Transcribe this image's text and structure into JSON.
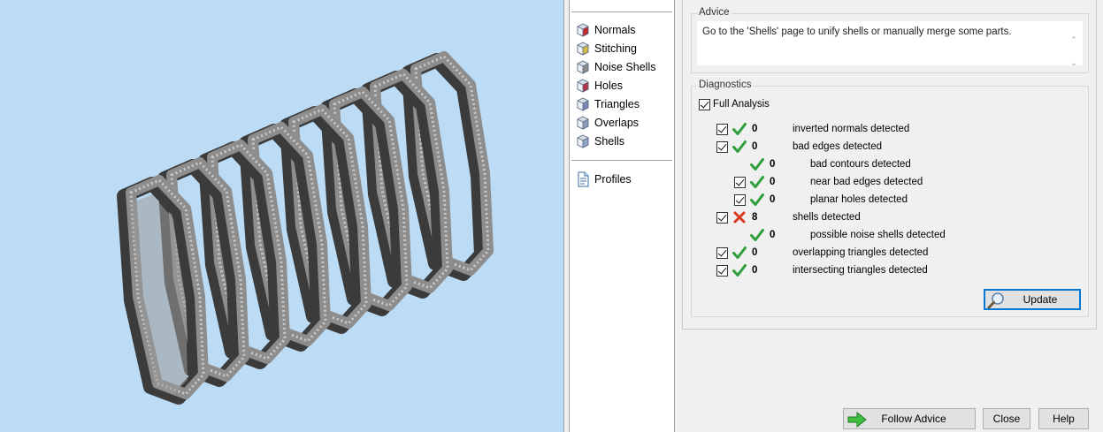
{
  "nav": {
    "checks": [
      {
        "label": "Normals",
        "icon": "normals-icon"
      },
      {
        "label": "Stitching",
        "icon": "stitching-icon"
      },
      {
        "label": "Noise Shells",
        "icon": "noise-shells-icon"
      },
      {
        "label": "Holes",
        "icon": "holes-icon"
      },
      {
        "label": "Triangles",
        "icon": "triangles-icon"
      },
      {
        "label": "Overlaps",
        "icon": "overlaps-icon"
      },
      {
        "label": "Shells",
        "icon": "shells-icon"
      }
    ],
    "profiles_label": "Profiles"
  },
  "advice": {
    "title": "Advice",
    "text": "Go to the 'Shells' page to unify shells or manually merge some parts."
  },
  "diagnostics": {
    "title": "Diagnostics",
    "full_analysis_label": "Full Analysis",
    "full_analysis_checked": true,
    "rows": [
      {
        "label": "inverted normals detected",
        "count": "0",
        "status": "ok",
        "checkbox": true,
        "indent": 0
      },
      {
        "label": "bad edges detected",
        "count": "0",
        "status": "ok",
        "checkbox": true,
        "indent": 0
      },
      {
        "label": "bad contours detected",
        "count": "0",
        "status": "ok",
        "checkbox": false,
        "indent": 1
      },
      {
        "label": "near bad edges detected",
        "count": "0",
        "status": "ok",
        "checkbox": true,
        "indent": 1
      },
      {
        "label": "planar holes detected",
        "count": "0",
        "status": "ok",
        "checkbox": true,
        "indent": 1
      },
      {
        "label": "shells detected",
        "count": "8",
        "status": "error",
        "checkbox": true,
        "indent": 0
      },
      {
        "label": "possible noise shells detected",
        "count": "0",
        "status": "ok",
        "checkbox": false,
        "indent": 1
      },
      {
        "label": "overlapping triangles detected",
        "count": "0",
        "status": "ok",
        "checkbox": true,
        "indent": 0
      },
      {
        "label": "intersecting triangles detected",
        "count": "0",
        "status": "ok",
        "checkbox": true,
        "indent": 0
      }
    ],
    "update_label": "Update"
  },
  "footer": {
    "follow_advice_label": "Follow Advice",
    "close_label": "Close",
    "help_label": "Help"
  },
  "colors": {
    "viewport_bg": "#bcdcf6",
    "ok": "#2e9e3a",
    "error": "#d9381e",
    "accent": "#0078d7"
  }
}
